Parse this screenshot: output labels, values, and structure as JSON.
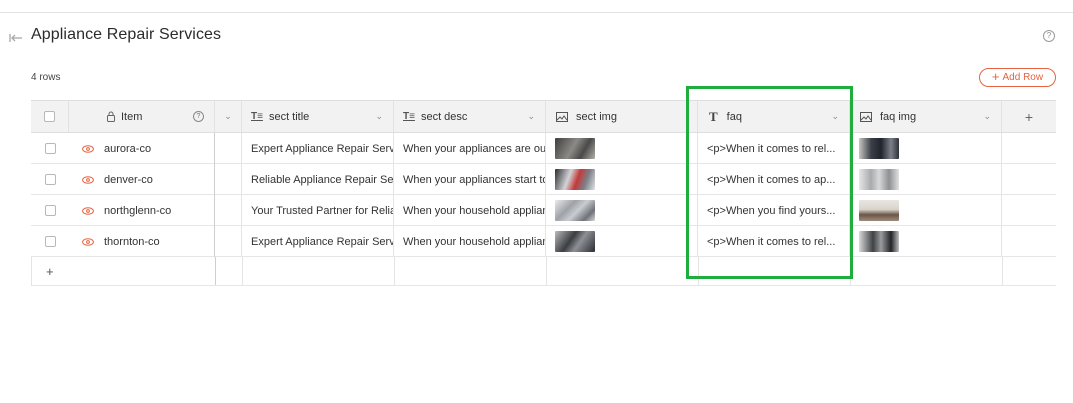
{
  "page": {
    "title": "Appliance Repair Services",
    "help_icon": "question-circle-icon"
  },
  "meta": {
    "row_count": "4 rows"
  },
  "toolbar": {
    "add_row_label": "Add Row",
    "add_row_plus": "+"
  },
  "columns": {
    "item": "Item",
    "sect_title": "sect title",
    "sect_desc": "sect desc",
    "sect_img": "sect img",
    "faq": "faq",
    "faq_img": "faq img",
    "add": "+"
  },
  "rows": [
    {
      "item": "aurora-co",
      "sect_title": "Expert Appliance Repair Services",
      "sect_desc": "When your appliances are out of order",
      "faq": "<p>When it comes to rel...",
      "sect_img_color": "#6d6a66",
      "faq_img_color": "#5c6470"
    },
    {
      "item": "denver-co",
      "sect_title": "Reliable Appliance Repair Services",
      "sect_desc": "When your appliances start to fail",
      "faq": "<p>When it comes to ap...",
      "sect_img_color": "#8a8f96",
      "faq_img_color": "#b9bcbf"
    },
    {
      "item": "northglenn-co",
      "sect_title": "Your Trusted Partner for Reliable",
      "sect_desc": "When your household appliances",
      "faq": "<p>When you find yours...",
      "sect_img_color": "#a9acb0",
      "faq_img_color": "#8b7a6c"
    },
    {
      "item": "thornton-co",
      "sect_title": "Expert Appliance Repair Services",
      "sect_desc": "When your household appliances",
      "faq": "<p>When it comes to rel...",
      "sect_img_color": "#5d6065",
      "faq_img_color": "#6f7376"
    }
  ],
  "footer": {
    "add_label": "+"
  },
  "colors": {
    "accent": "#e8623f",
    "highlight": "#1fae3e"
  }
}
